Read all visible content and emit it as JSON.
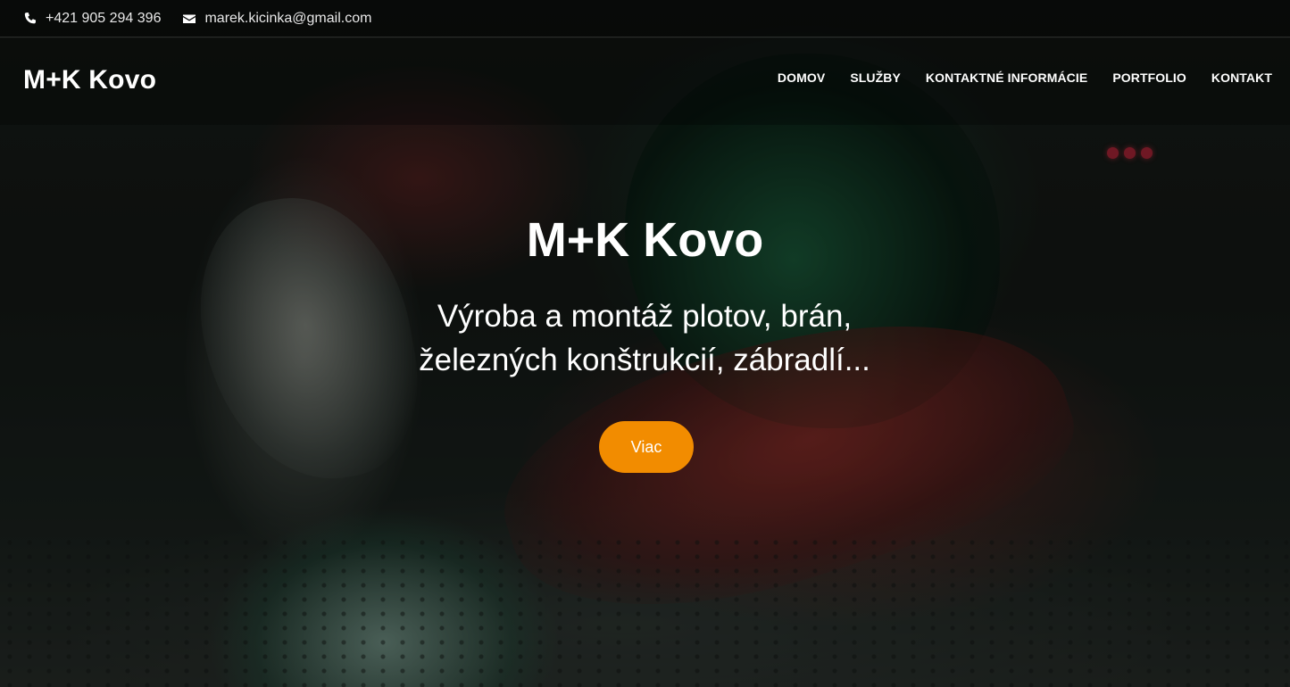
{
  "topbar": {
    "phone": {
      "icon": "phone-icon",
      "text": "+421 905 294 396"
    },
    "email": {
      "icon": "envelope-icon",
      "text": "marek.kicinka@gmail.com"
    }
  },
  "header": {
    "logo": "M+K Kovo",
    "nav": [
      {
        "label": "DOMOV"
      },
      {
        "label": "SLUŽBY"
      },
      {
        "label": "KONTAKTNÉ INFORMÁCIE"
      },
      {
        "label": "PORTFOLIO"
      },
      {
        "label": "KONTAKT"
      }
    ]
  },
  "hero": {
    "title": "M+K Kovo",
    "subtitle": "Výroba a montáž plotov, brán, železných konštrukcií, zábradlí...",
    "cta_label": "Viac",
    "cta_color": "#f28c00"
  }
}
